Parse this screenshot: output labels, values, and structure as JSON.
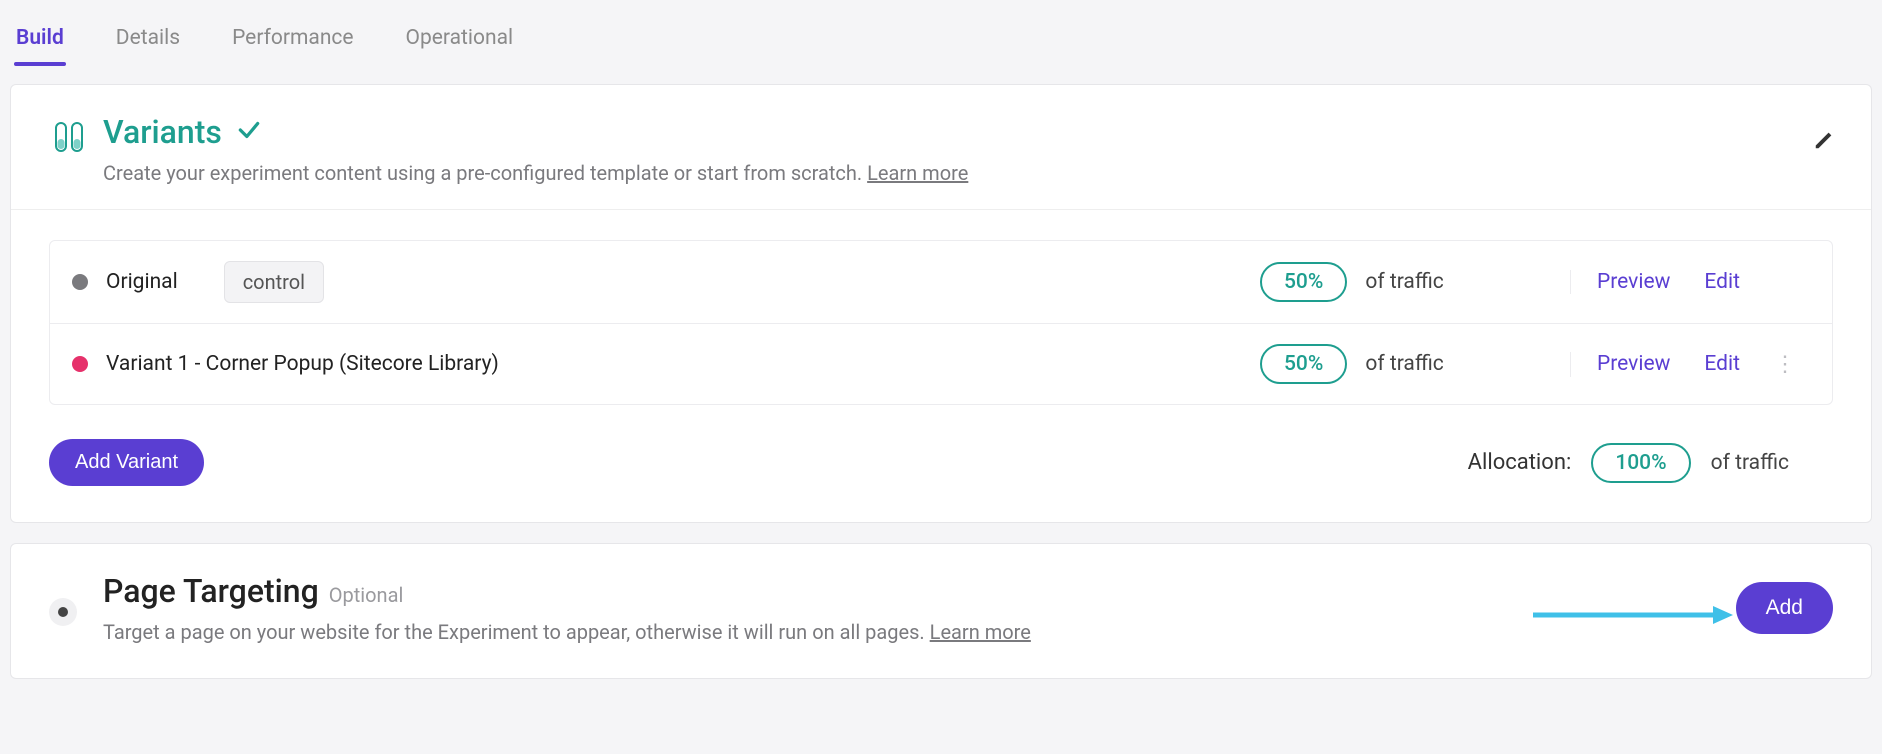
{
  "tabs": {
    "build": "Build",
    "details": "Details",
    "performance": "Performance",
    "operational": "Operational"
  },
  "variants_card": {
    "title": "Variants",
    "subtitle_pre": "Create your experiment content using a pre-configured template or start from scratch. ",
    "learn_more": "Learn more",
    "add_variant_label": "Add Variant",
    "allocation_label": "Allocation:",
    "allocation_value": "100%",
    "allocation_suffix": "of traffic",
    "rows": [
      {
        "name": "Original",
        "control_chip": "control",
        "traffic_pct": "50%",
        "traffic_suffix": "of traffic",
        "preview": "Preview",
        "edit": "Edit",
        "dot": "gray",
        "has_menu": false
      },
      {
        "name": "Variant 1 - Corner Popup (Sitecore Library)",
        "control_chip": "",
        "traffic_pct": "50%",
        "traffic_suffix": "of traffic",
        "preview": "Preview",
        "edit": "Edit",
        "dot": "pink",
        "has_menu": true
      }
    ]
  },
  "targeting_card": {
    "title": "Page Targeting",
    "optional": "Optional",
    "subtitle_pre": "Target a page on your website for the Experiment to appear, otherwise it will run on all pages. ",
    "learn_more": "Learn more",
    "add_label": "Add"
  },
  "colors": {
    "primary": "#5a3ed2",
    "accent": "#1e9e8f",
    "arrow": "#3fc0e8"
  }
}
